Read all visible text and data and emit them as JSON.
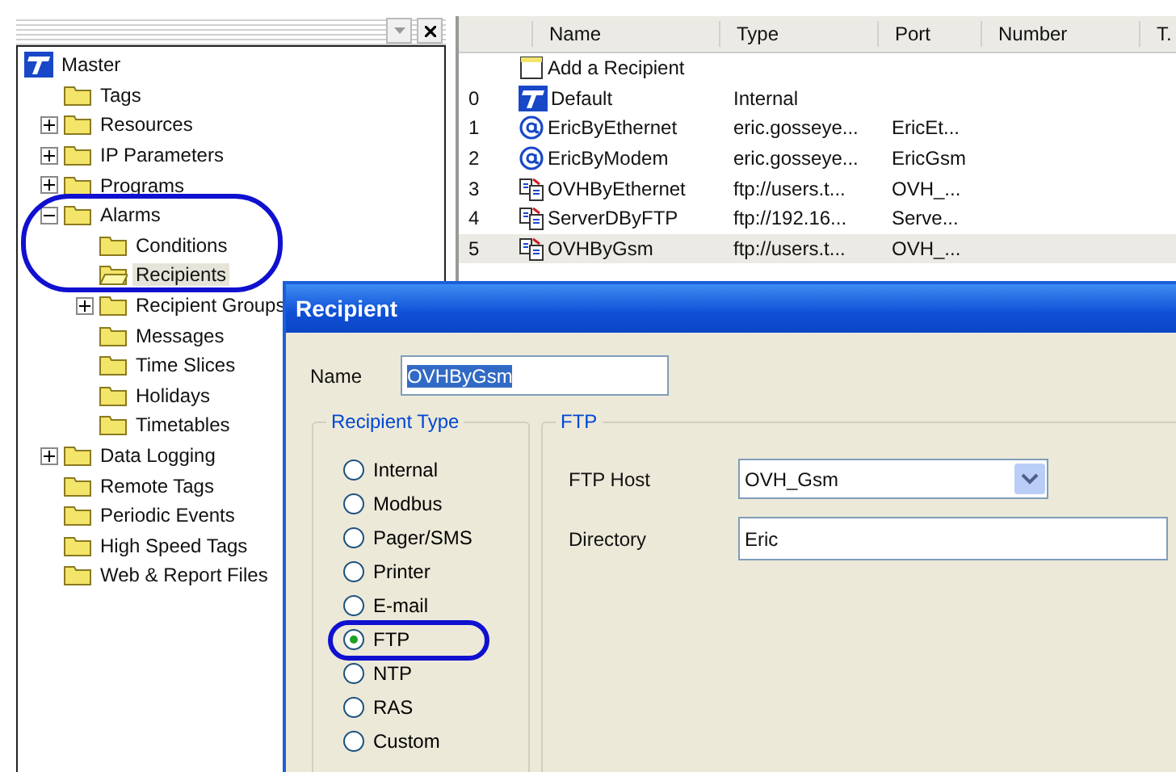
{
  "tree_pane": {
    "tree": [
      {
        "label": "Master",
        "kind": "logo",
        "selected": false,
        "children": [
          {
            "label": "Tags",
            "kind": "folder",
            "selected": false
          },
          {
            "label": "Resources",
            "kind": "folder",
            "selected": false,
            "expanded": false
          },
          {
            "label": "IP Parameters",
            "kind": "folder",
            "selected": false,
            "expanded": false
          },
          {
            "label": "Programs",
            "kind": "folder",
            "selected": false,
            "expanded": false
          },
          {
            "label": "Alarms",
            "kind": "folder",
            "selected": false,
            "expanded": true,
            "children": [
              {
                "label": "Conditions",
                "kind": "folder",
                "selected": false
              },
              {
                "label": "Recipients",
                "kind": "folder",
                "selected": true
              },
              {
                "label": "Recipient Groups",
                "kind": "folder",
                "selected": false,
                "expanded": false
              },
              {
                "label": "Messages",
                "kind": "folder",
                "selected": false
              },
              {
                "label": "Time Slices",
                "kind": "folder",
                "selected": false
              },
              {
                "label": "Holidays",
                "kind": "folder",
                "selected": false
              },
              {
                "label": "Timetables",
                "kind": "folder",
                "selected": false
              }
            ]
          },
          {
            "label": "Data Logging",
            "kind": "folder",
            "selected": false,
            "expanded": false
          },
          {
            "label": "Remote Tags",
            "kind": "folder",
            "selected": false
          },
          {
            "label": "Periodic Events",
            "kind": "folder",
            "selected": false
          },
          {
            "label": "High Speed Tags",
            "kind": "folder",
            "selected": false
          },
          {
            "label": "Web & Report Files",
            "kind": "folder",
            "selected": false
          }
        ]
      }
    ]
  },
  "table": {
    "columns": [
      "Name",
      "Type",
      "Port",
      "Number",
      "T."
    ],
    "rows": [
      {
        "kind": "add",
        "name": "Add a Recipient",
        "selected": false
      },
      {
        "index": "0",
        "kind": "internal",
        "name": "Default",
        "type": "Internal",
        "selected": false
      },
      {
        "index": "1",
        "kind": "email",
        "name": "EricByEthernet",
        "type": "eric.gosseye...",
        "port": "EricEt...",
        "selected": false
      },
      {
        "index": "2",
        "kind": "email",
        "name": "EricByModem",
        "type": "eric.gosseye...",
        "port": "EricGsm",
        "selected": false
      },
      {
        "index": "3",
        "kind": "ftp",
        "name": "OVHByEthernet",
        "type": "ftp://users.t...",
        "port": "OVH_...",
        "selected": false
      },
      {
        "index": "4",
        "kind": "ftp",
        "name": "ServerDByFTP",
        "type": "ftp://192.16...",
        "port": "Serve...",
        "selected": false
      },
      {
        "index": "5",
        "kind": "ftp",
        "name": "OVHByGsm",
        "type": "ftp://users.t...",
        "port": "OVH_...",
        "selected": true
      }
    ]
  },
  "dialog": {
    "title": "Recipient",
    "name_field": {
      "label": "Name",
      "value": "OVHByGsm",
      "selected": true
    },
    "recipient_type": {
      "legend": "Recipient Type",
      "options": [
        {
          "label": "Internal",
          "selected": false
        },
        {
          "label": "Modbus",
          "selected": false
        },
        {
          "label": "Pager/SMS",
          "selected": false
        },
        {
          "label": "Printer",
          "selected": false
        },
        {
          "label": "E-mail",
          "selected": false
        },
        {
          "label": "FTP",
          "selected": true
        },
        {
          "label": "NTP",
          "selected": false
        },
        {
          "label": "RAS",
          "selected": false
        },
        {
          "label": "Custom",
          "selected": false
        }
      ]
    },
    "ftp": {
      "legend": "FTP",
      "host_label": "FTP Host",
      "host_value": "OVH_Gsm",
      "directory_label": "Directory",
      "directory_value": "Eric"
    }
  }
}
